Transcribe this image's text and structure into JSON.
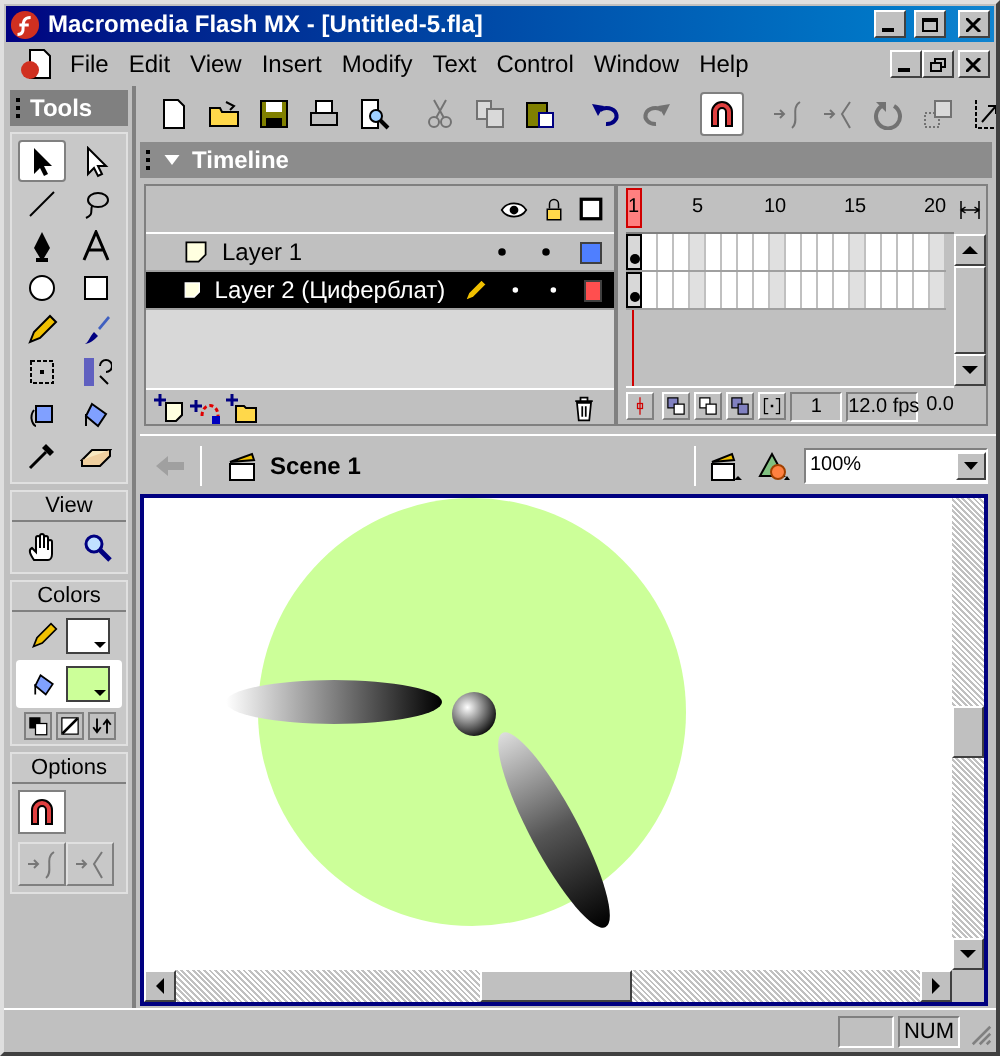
{
  "window": {
    "title": "Macromedia Flash MX - [Untitled-5.fla]"
  },
  "menu": [
    "File",
    "Edit",
    "View",
    "Insert",
    "Modify",
    "Text",
    "Control",
    "Window",
    "Help"
  ],
  "toolbar": [
    {
      "kind": "new",
      "disabled": false,
      "selected": false
    },
    {
      "kind": "open",
      "disabled": false,
      "selected": false
    },
    {
      "kind": "save",
      "disabled": false,
      "selected": false
    },
    {
      "kind": "print",
      "disabled": false,
      "selected": false
    },
    {
      "kind": "preview",
      "disabled": false,
      "selected": false
    },
    {
      "kind": "cut",
      "disabled": true,
      "selected": false
    },
    {
      "kind": "copy",
      "disabled": true,
      "selected": false
    },
    {
      "kind": "paste",
      "disabled": false,
      "selected": false
    },
    {
      "kind": "undo",
      "disabled": false,
      "selected": false
    },
    {
      "kind": "redo",
      "disabled": true,
      "selected": false
    },
    {
      "kind": "snap",
      "disabled": false,
      "selected": true
    },
    {
      "kind": "smooth",
      "disabled": true,
      "selected": false
    },
    {
      "kind": "straighten",
      "disabled": true,
      "selected": false
    },
    {
      "kind": "rotate",
      "disabled": true,
      "selected": false
    },
    {
      "kind": "scale",
      "disabled": true,
      "selected": false
    },
    {
      "kind": "align",
      "disabled": false,
      "selected": false
    }
  ],
  "tools_panel": {
    "title": "Tools",
    "tools": [
      {
        "kind": "arrow",
        "selected": true
      },
      {
        "kind": "subselect",
        "selected": false
      },
      {
        "kind": "line",
        "selected": false
      },
      {
        "kind": "lasso",
        "selected": false
      },
      {
        "kind": "pen",
        "selected": false
      },
      {
        "kind": "text",
        "selected": false
      },
      {
        "kind": "oval",
        "selected": false
      },
      {
        "kind": "rect",
        "selected": false
      },
      {
        "kind": "pencil",
        "selected": false
      },
      {
        "kind": "brush",
        "selected": false
      },
      {
        "kind": "transform",
        "selected": false
      },
      {
        "kind": "filltransform",
        "selected": false
      },
      {
        "kind": "ink",
        "selected": false
      },
      {
        "kind": "bucket",
        "selected": false
      },
      {
        "kind": "eyedropper",
        "selected": false
      },
      {
        "kind": "eraser",
        "selected": false
      }
    ],
    "view_title": "View",
    "view_tools": [
      {
        "kind": "hand",
        "selected": false
      },
      {
        "kind": "zoom",
        "selected": false
      }
    ],
    "colors_title": "Colors",
    "stroke": {
      "color": "#ffffff",
      "selected": false
    },
    "fill": {
      "color": "#ccff99",
      "selected": true
    },
    "options_title": "Options",
    "options": [
      {
        "kind": "snap",
        "selected": true,
        "disabled": false
      },
      {
        "kind": "smooth",
        "selected": false,
        "disabled": true
      },
      {
        "kind": "straighten",
        "selected": false,
        "disabled": true
      }
    ]
  },
  "timeline": {
    "title": "Timeline",
    "ruler": [
      "1",
      "5",
      "10",
      "15",
      "20"
    ],
    "layers": [
      {
        "name": "Layer 1",
        "selected": false,
        "editing": false,
        "color": "#4f7fff"
      },
      {
        "name": "Layer 2 (Циферблат)",
        "selected": true,
        "editing": true,
        "color": "#ff4f4f"
      }
    ],
    "current_frame": "1",
    "frame_rate": "12.0 fps",
    "elapsed": "0.0"
  },
  "scene_bar": {
    "scene": "Scene 1",
    "zoom": "100%"
  },
  "status_bar": {
    "num": "NUM"
  }
}
